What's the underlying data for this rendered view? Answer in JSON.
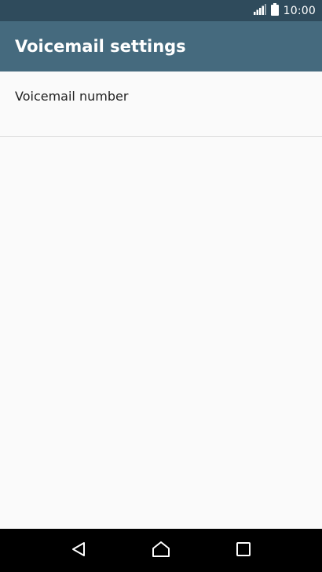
{
  "status_bar": {
    "time": "10:00",
    "icons": [
      "signal-icon",
      "battery-icon"
    ]
  },
  "app_bar": {
    "title": "Voicemail settings"
  },
  "settings": {
    "items": [
      {
        "label": "Voicemail number"
      }
    ]
  },
  "nav_bar": {
    "buttons": [
      "back-icon",
      "home-icon",
      "recents-icon"
    ]
  },
  "colors": {
    "status_bar": "#2f4b5c",
    "app_bar": "#456a7e",
    "background": "#fafafa",
    "nav_bar": "#000000"
  }
}
